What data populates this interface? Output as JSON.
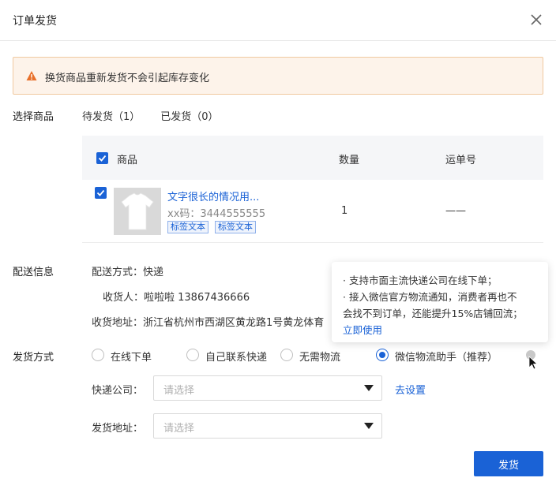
{
  "header": {
    "title": "订单发货"
  },
  "alert": {
    "text": "换货商品重新发货不会引起库存变化",
    "color": "#f0c9a0"
  },
  "select_goods": {
    "label": "选择商品",
    "tabs": [
      {
        "label": "待发货（1）"
      },
      {
        "label": "已发货（0）"
      }
    ],
    "table": {
      "headers": {
        "product": "商品",
        "quantity": "数量",
        "tracking": "运单号"
      },
      "rows": [
        {
          "name": "文字很长的情况用...",
          "sku": "xx码：3444555555",
          "tags": [
            "标签文本",
            "标签文本"
          ],
          "quantity": "1",
          "tracking": "——",
          "checked": true
        }
      ]
    }
  },
  "delivery_info": {
    "label": "配送信息",
    "method": "配送方式：快递",
    "recipient": "收货人：啦啦啦 13867436666",
    "address": "收货地址：浙江省杭州市西湖区黄龙路1号黄龙体育"
  },
  "tooltip": {
    "lines": [
      "· 支持市面主流快递公司在线下单；",
      "· 接入微信官方物流通知，消费者再也不",
      "会找不到订单，还能提升15%店铺回流；"
    ],
    "link": "立即使用"
  },
  "ship_method": {
    "label": "发货方式",
    "options": [
      {
        "label": "在线下单",
        "selected": false
      },
      {
        "label": "自己联系快递",
        "selected": false
      },
      {
        "label": "无需物流",
        "selected": false
      },
      {
        "label": "微信物流助手（推荐）",
        "selected": true
      }
    ]
  },
  "courier": {
    "label": "快递公司：",
    "placeholder": "请选择",
    "setup_link": "去设置"
  },
  "ship_address": {
    "label": "发货地址：",
    "placeholder": "请选择"
  },
  "submit": {
    "label": "发货"
  },
  "colors": {
    "primary": "#1a62d6",
    "alert_bg": "#fdf3ea",
    "warning": "#e8702a"
  }
}
